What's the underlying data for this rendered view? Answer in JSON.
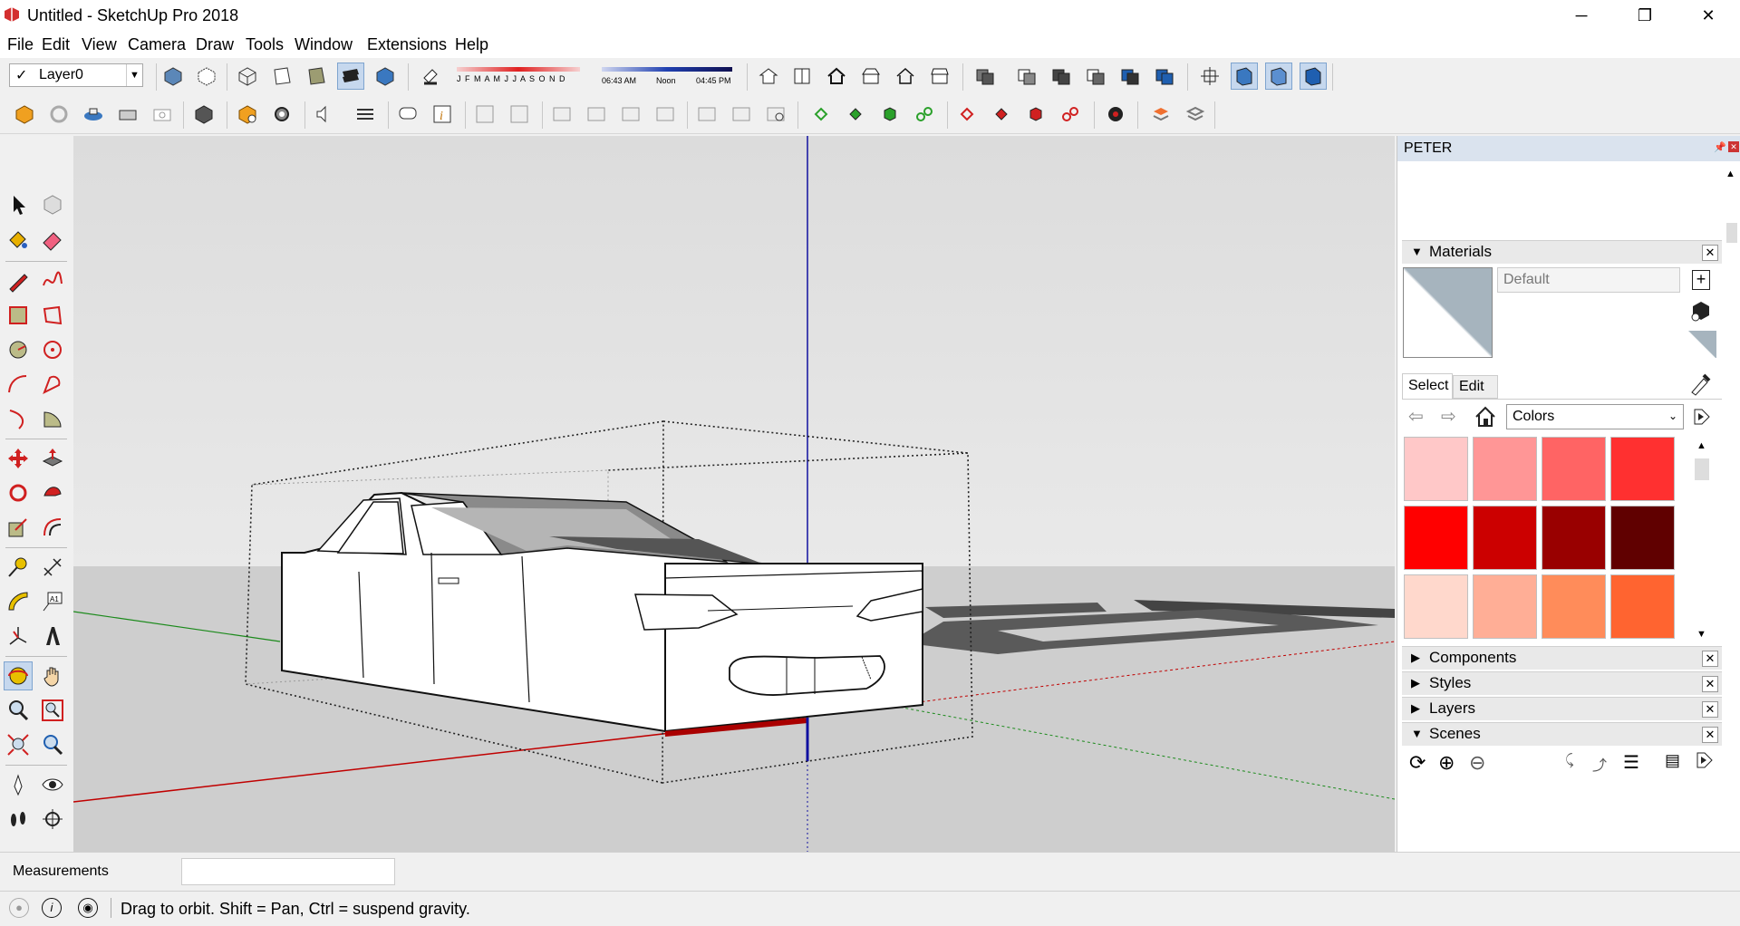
{
  "window": {
    "title": "Untitled - SketchUp Pro 2018",
    "minimize": "─",
    "restore": "❐",
    "close": "✕"
  },
  "menu": [
    "File",
    "Edit",
    "View",
    "Camera",
    "Draw",
    "Tools",
    "Window",
    "Extensions",
    "Help"
  ],
  "toolbar": {
    "layer_check": "✓",
    "layer_value": "Layer0",
    "months": "J F M A M J J A S O N D",
    "time_start": "06:43 AM",
    "time_noon": "Noon",
    "time_end": "04:45 PM"
  },
  "panel": {
    "title": "PETER",
    "materials": {
      "header": "Materials",
      "material_name": "Default",
      "tab_select": "Select",
      "tab_edit": "Edit",
      "library": "Colors",
      "swatches": [
        "#ffc8c8",
        "#ff9696",
        "#ff6464",
        "#ff3030",
        "#ff0000",
        "#cc0000",
        "#990000",
        "#600000",
        "#ffd8cc",
        "#ffae96",
        "#ff8c5a",
        "#ff6430"
      ]
    },
    "sections": [
      "Components",
      "Styles",
      "Layers",
      "Scenes"
    ]
  },
  "status": {
    "measurements_label": "Measurements",
    "measurements_value": "",
    "hint": "Drag to orbit. Shift = Pan, Ctrl = suspend gravity."
  },
  "colors": {
    "accent": "#4a90d9",
    "panel_title_bg": "#dae3ee",
    "axis_red": "#c00000",
    "axis_green": "#1b8a1b",
    "axis_blue": "#1010a0"
  }
}
